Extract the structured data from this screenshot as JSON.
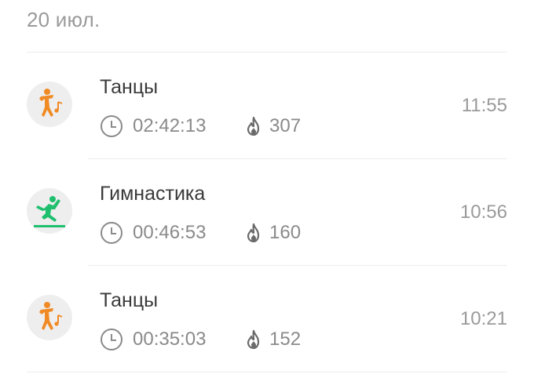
{
  "date_header": "20 июл.",
  "colors": {
    "dance_accent": "#f08a24",
    "gym_accent": "#1fbf6e"
  },
  "workouts": [
    {
      "title": "Танцы",
      "duration": "02:42:13",
      "calories": "307",
      "time": "11:55",
      "icon": "dance-icon"
    },
    {
      "title": "Гимнастика",
      "duration": "00:46:53",
      "calories": "160",
      "time": "10:56",
      "icon": "gymnastics-icon"
    },
    {
      "title": "Танцы",
      "duration": "00:35:03",
      "calories": "152",
      "time": "10:21",
      "icon": "dance-icon"
    }
  ]
}
